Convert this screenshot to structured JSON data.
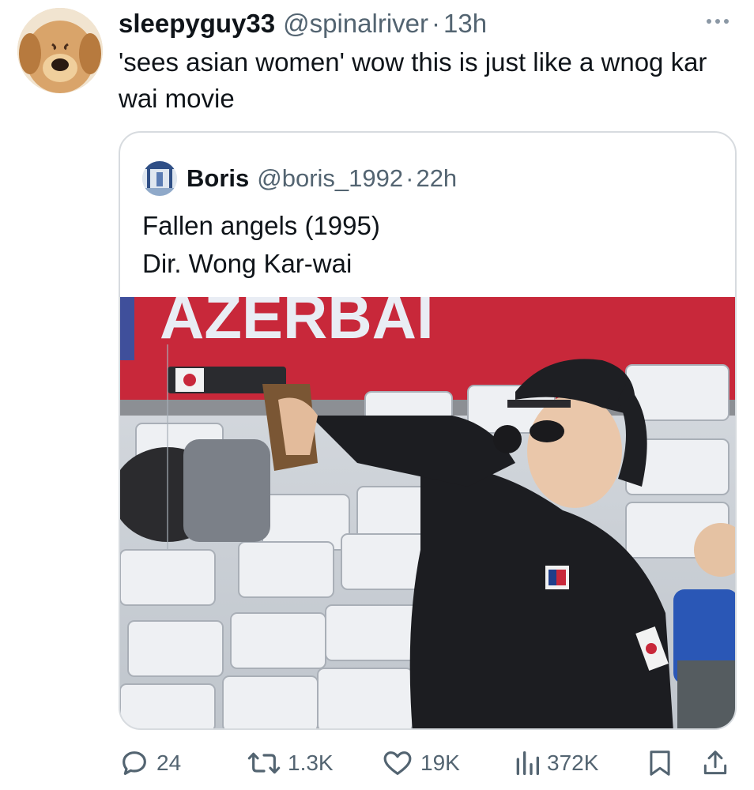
{
  "author": {
    "display_name": "sleepyguy33",
    "handle": "@spinalriver",
    "separator": "·",
    "time": "13h",
    "avatar_icon": "dog-avatar-icon"
  },
  "tweet": {
    "text": "'sees asian women' wow this is just like  a wnog kar wai movie"
  },
  "quoted": {
    "display_name": "Boris",
    "handle": "@boris_1992",
    "separator": "·",
    "time": "22h",
    "lines": [
      "Fallen angels (1995)",
      "Dir. Wong Kar-wai"
    ],
    "media_icon": "shooter-photo",
    "banner_text": "AZERBAI"
  },
  "actions": {
    "reply_count": "24",
    "retweet_count": "1.3K",
    "like_count": "19K",
    "views_count": "372K"
  },
  "colors": {
    "text": "#0f1419",
    "secondary": "#536471",
    "border": "#d7dbdf",
    "banner_red": "#c8283a"
  }
}
